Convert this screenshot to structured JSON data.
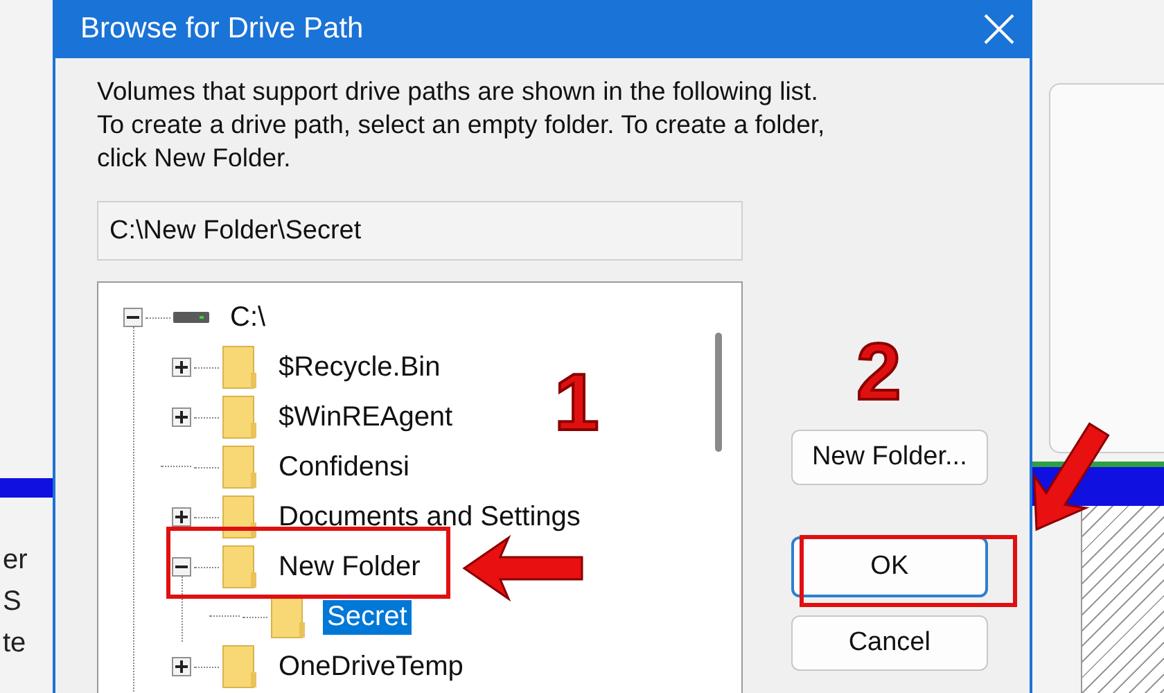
{
  "dialog": {
    "title": "Browse for Drive Path",
    "description_lines": [
      "Volumes that support drive paths are shown in the following list.",
      "To create a drive path, select an empty folder. To create a folder,",
      "click New Folder."
    ],
    "path": "C:\\New Folder\\Secret",
    "tree": [
      {
        "label": "C:\\",
        "kind": "drive",
        "expandable": true,
        "expanded": true,
        "selected": false,
        "children": [
          {
            "label": "$Recycle.Bin",
            "kind": "folder",
            "expandable": true,
            "expanded": false,
            "selected": false
          },
          {
            "label": "$WinREAgent",
            "kind": "folder",
            "expandable": true,
            "expanded": false,
            "selected": false
          },
          {
            "label": "Confidensi",
            "kind": "folder",
            "expandable": false,
            "selected": false
          },
          {
            "label": "Documents and Settings",
            "kind": "folder",
            "expandable": true,
            "expanded": false,
            "selected": false
          },
          {
            "label": "New Folder",
            "kind": "folder",
            "expandable": true,
            "expanded": true,
            "selected": false,
            "children": [
              {
                "label": "Secret",
                "kind": "folder",
                "expandable": false,
                "selected": true
              }
            ]
          },
          {
            "label": "OneDriveTemp",
            "kind": "folder",
            "expandable": true,
            "expanded": false,
            "selected": false
          }
        ]
      }
    ],
    "buttons": [
      {
        "label": "New Folder...",
        "default": false
      },
      {
        "label": "OK",
        "default": true
      },
      {
        "label": "Cancel",
        "default": false
      }
    ]
  },
  "background_window": {
    "labels": [
      "er",
      "S",
      "te"
    ]
  },
  "annotations": [
    {
      "text": "1"
    },
    {
      "text": "2"
    }
  ]
}
